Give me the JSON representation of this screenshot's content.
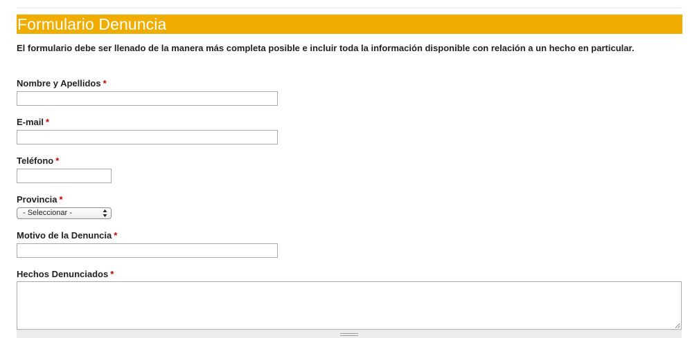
{
  "form": {
    "title": "Formulario Denuncia",
    "intro": "El formulario debe ser llenado de la manera más completa posible e incluir toda la información disponible con relación a un hecho en particular.",
    "required_mark": "*",
    "fields": {
      "nombre": {
        "label": "Nombre y Apellidos",
        "value": ""
      },
      "email": {
        "label": "E-mail",
        "value": ""
      },
      "telefono": {
        "label": "Teléfono",
        "value": ""
      },
      "provincia": {
        "label": "Provincia",
        "selected": "- Seleccionar -"
      },
      "motivo": {
        "label": "Motivo de la Denuncia",
        "value": ""
      },
      "hechos": {
        "label": "Hechos Denunciados",
        "value": ""
      }
    }
  },
  "colors": {
    "header_bg": "#f0ad00",
    "header_text": "#ffffff",
    "required": "#cc0000"
  },
  "icons": {
    "select_arrow": "up-down-arrows-icon",
    "textarea_resize": "resize-grip-icon",
    "drag_handle": "drag-handle-icon"
  }
}
